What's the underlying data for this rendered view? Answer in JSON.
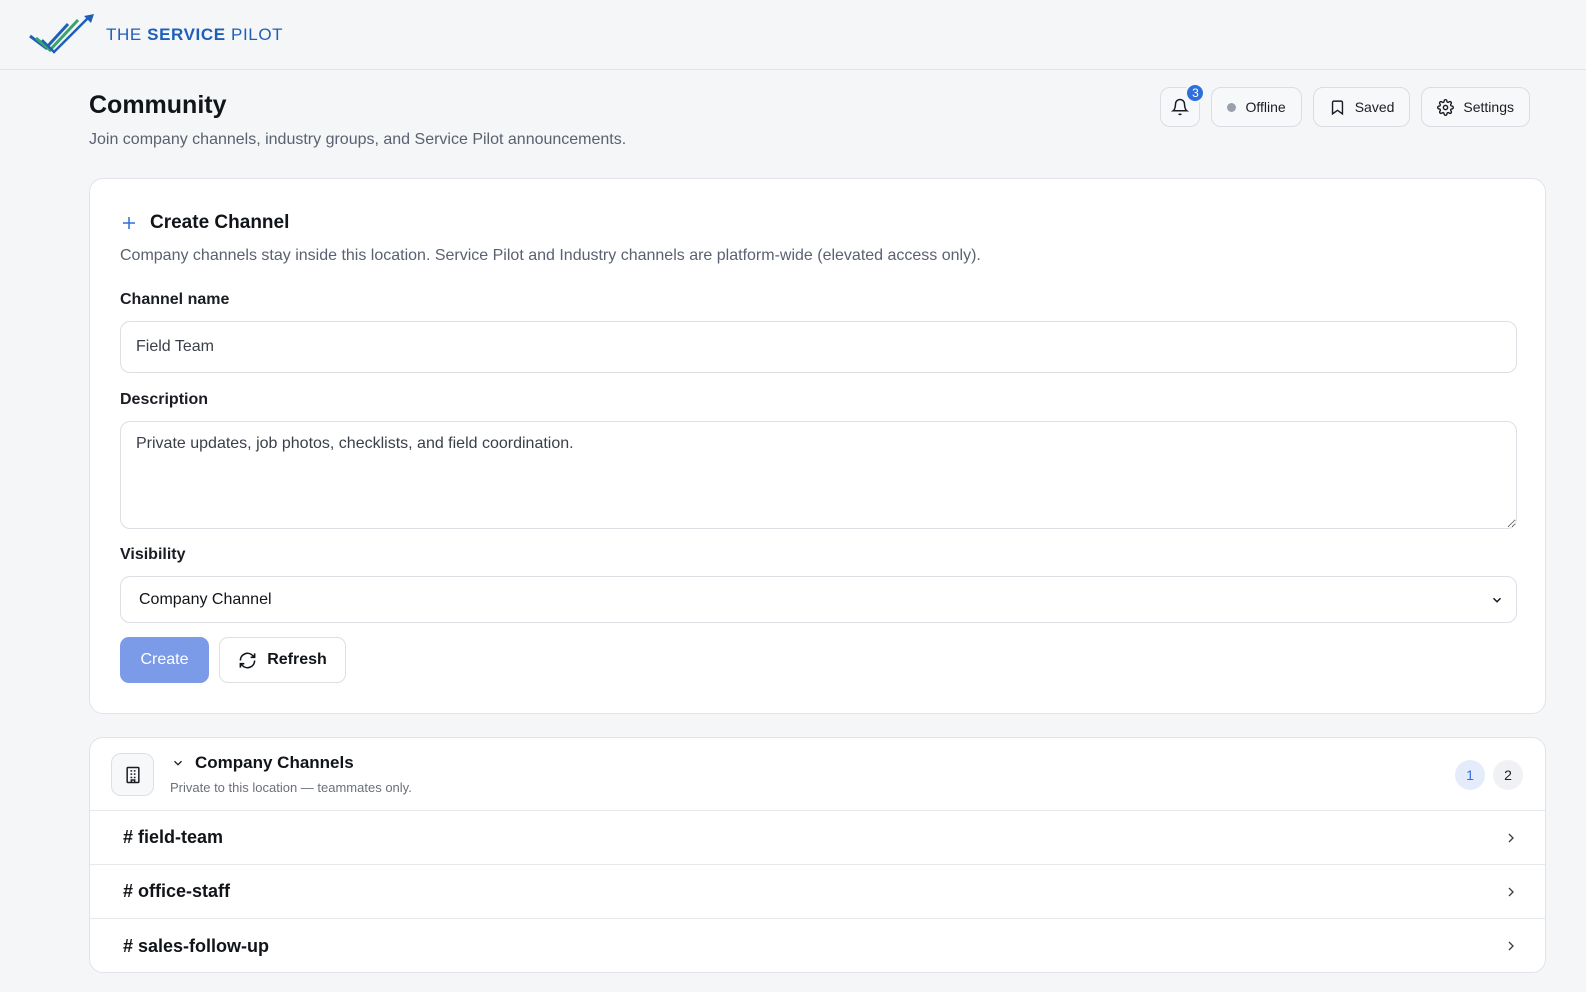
{
  "brand": {
    "logo_prefix": "THE",
    "logo_bold": "SERVICE",
    "logo_suffix": "PILOT",
    "colors": {
      "primary": "#1f5fb8",
      "accent": "#2f6fdb",
      "logo_green": "#3aa56b"
    }
  },
  "header": {
    "title": "Community",
    "subtitle": "Join company channels, industry groups, and Service Pilot announcements.",
    "notifications_count": "3",
    "status_label": "Offline",
    "saved_label": "Saved",
    "settings_label": "Settings"
  },
  "create_channel": {
    "title": "Create Channel",
    "description": "Company channels stay inside this location. Service Pilot and Industry channels are platform-wide (elevated access only).",
    "name_label": "Channel name",
    "name_value": "Field Team",
    "description_label": "Description",
    "description_value": "Private updates, job photos, checklists, and field coordination.",
    "visibility_label": "Visibility",
    "visibility_value": "Company Channel",
    "create_label": "Create",
    "refresh_label": "Refresh"
  },
  "company_channels": {
    "title": "Company Channels",
    "subtitle": "Private to this location — teammates only.",
    "pages": [
      "1",
      "2"
    ],
    "current_page": "1",
    "items": [
      {
        "name": "# field-team"
      },
      {
        "name": "# office-staff"
      },
      {
        "name": "# sales-follow-up"
      }
    ]
  },
  "icons": [
    "logo-checkmark-icon",
    "bell-icon",
    "status-dot-icon",
    "bookmark-icon",
    "gear-icon",
    "plus-icon",
    "chevron-down-icon",
    "refresh-icon",
    "building-icon",
    "chevron-right-icon"
  ]
}
